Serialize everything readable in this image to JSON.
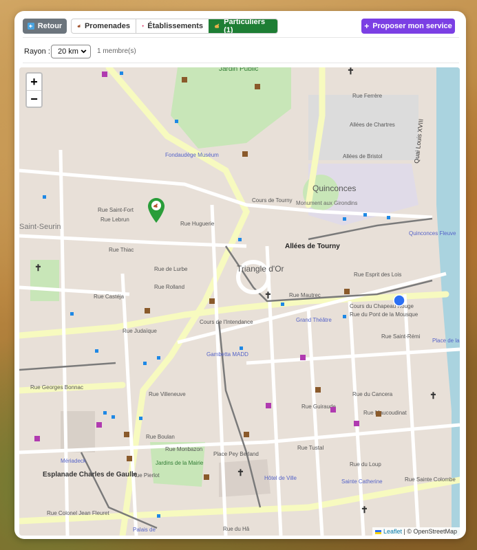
{
  "toolbar": {
    "back_label": "Retour",
    "tabs": [
      {
        "label": "Promenades",
        "icon": "dog-icon"
      },
      {
        "label": "Établissements",
        "icon": "pin-icon"
      },
      {
        "label": "Particuliers (1)",
        "icon": "dog-icon",
        "active": true
      }
    ],
    "propose_label": "Proposer mon service"
  },
  "filter": {
    "radius_label": "Rayon :",
    "radius_value": "20 km",
    "member_count": "1 membre(s)"
  },
  "map": {
    "zoom_in": "+",
    "zoom_out": "−",
    "attribution_leaflet": "Leaflet",
    "attribution_sep": " | © ",
    "attribution_osm": "OpenStreetMap",
    "labels": {
      "jardin_public": "Jardin Public",
      "quinconces": "Quinconces",
      "allees_tourny": "Allées de Tourny",
      "triangle_or": "Triangle d'Or",
      "saint_seurin": "Saint-Seurin",
      "esplanade": "Esplanade Charles de Gaulle",
      "fondaudege": "Fondaudège Muséum",
      "monument": "Monument aux Girondins",
      "grand_theatre": "Grand Théâtre",
      "gambetta_madd": "Gambetta MADD",
      "meriadeck": "Mériadeck",
      "jardins_mairie": "Jardins de la Mairie",
      "hotel_ville": "Hôtel de Ville",
      "place_bourse": "Place de la Bourse",
      "sainte_catherine": "Sainte Catherine",
      "palais_justice": "Palais de",
      "quai": "Quai Louis XVIII",
      "rue_huguerie": "Rue Huguerie",
      "cours_intendance": "Cours de l'Intendance",
      "rue_judaique": "Rue Judaïque",
      "rue_georges_bonnac": "Rue Georges Bonnac",
      "place_pey_berland": "Place Pey Berland",
      "cours_chapeau_rouge": "Cours du Chapeau Rouge",
      "rue_esprit_des_lois": "Rue Esprit des Lois",
      "allees_chartres": "Allées de Chartres",
      "allees_bristol": "Allées de Bristol",
      "rue_ferrere": "Rue Ferrère",
      "rue_rolland": "Rue Rolland",
      "rue_castega": "Rue Castéja",
      "rue_lurbe": "Rue de Lurbe",
      "rue_thiac": "Rue Thiac",
      "rue_lebrun": "Rue Lebrun",
      "rue_saint_fort": "Rue Saint-Fort",
      "rue_du_loup": "Rue du Loup",
      "rue_tustal": "Rue Tustal",
      "rue_guiraude": "Rue Guiraude",
      "rue_cancera": "Rue du Cancera",
      "rue_boulan": "Rue Boulan",
      "rue_monbazon": "Rue Monbazon",
      "rue_pierlot": "Rue Pierlot",
      "rue_villeneuve": "Rue Villeneuve",
      "rue_maucoudinat": "Rue Maucoudinat",
      "rue_colonel_fleuret": "Rue Colonel Jean Fleuret",
      "quinconces_fleuve": "Quinconces Fleuve",
      "rue_hugo": "Rue du Hâ",
      "rue_mautrec": "Rue Mautrec",
      "cours_tourny": "Cours de Tourny",
      "rue_pont_mousque": "Rue du Pont de la Mousque",
      "rue_saint_remi": "Rue Saint-Rémi",
      "rue_sainte_colombe": "Rue Sainte Colombe"
    }
  },
  "colors": {
    "back_button": "#6c757d",
    "active_tab": "#1e7e34",
    "propose_button": "#7b3fe4",
    "marker": "#2a9d3a",
    "user_location": "#2b6ff3"
  }
}
